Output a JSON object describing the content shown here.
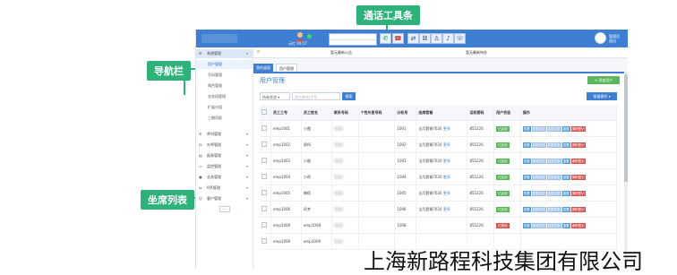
{
  "callouts": {
    "toolbar": "通话工具条",
    "nav": "导航栏",
    "seats": "坐席列表"
  },
  "topbar": {
    "agent_status": "示忙 00:17",
    "user_name": "管理员",
    "user_sub": "退出"
  },
  "notice": {
    "n1": "暂无最新公告",
    "n2": "暂无最新待办"
  },
  "sidebar": {
    "items": [
      {
        "label": "系统管理",
        "icon": "gear-icon"
      },
      {
        "label": "用户管理"
      },
      {
        "label": "号码管理"
      },
      {
        "label": "角色管理"
      },
      {
        "label": "业务组管理"
      },
      {
        "label": "扩展分组"
      },
      {
        "label": "三期用助"
      },
      {
        "label": "呼叫管理",
        "icon": "phone-icon"
      },
      {
        "label": "外呼管理",
        "icon": "headset-icon"
      },
      {
        "label": "报表管理",
        "icon": "report-icon"
      },
      {
        "label": "监控管理",
        "icon": "monitor-icon"
      },
      {
        "label": "业务管理",
        "icon": "briefcase-icon"
      },
      {
        "label": "IVR管理",
        "icon": "flow-icon"
      },
      {
        "label": "客户管理",
        "icon": "users-icon"
      }
    ]
  },
  "tabs": [
    "我的桌面",
    "用户管理"
  ],
  "panel": {
    "title": "用户管理",
    "add_btn": "+ 添加用户",
    "filter_select": "所有状态 ▾",
    "filter_placeholder": "员工姓名/工号",
    "search_btn": "搜索",
    "batch_btn": "批量操作 ▾"
  },
  "table": {
    "headers": [
      "",
      "员工工号",
      "员工姓名",
      "联系号码",
      "个性外显号码",
      "分机号",
      "坐席套餐",
      "话机密码",
      "用户状态",
      "操作"
    ],
    "rows": [
      {
        "id": "emp1001",
        "name": "小霞",
        "ext": "1001",
        "pkg": "当月套餐7020",
        "more": "更多",
        "pwd": "855226",
        "status": "已启用"
      },
      {
        "id": "emp1002",
        "name": "周所",
        "ext": "1002",
        "pkg": "当月套餐7020",
        "more": "更多",
        "pwd": "855226",
        "status": "已启用"
      },
      {
        "id": "emp1003",
        "name": "小磊",
        "ext": "1003",
        "pkg": "当月套餐7020",
        "more": "更多",
        "pwd": "855226",
        "status": "已启用"
      },
      {
        "id": "emp1004",
        "name": "小帮",
        "ext": "1004",
        "pkg": "当月套餐7020",
        "more": "更多",
        "pwd": "855226",
        "status": "已启用"
      },
      {
        "id": "emp1005",
        "name": "楠宿",
        "ext": "1005",
        "pkg": "当月套餐7020",
        "more": "更多",
        "pwd": "855226",
        "status": "已启用"
      },
      {
        "id": "emp1006",
        "name": "阿考",
        "ext": "1006",
        "pkg": "当月套餐7020",
        "more": "更多",
        "pwd": "855226",
        "status": "已启用"
      },
      {
        "id": "emp1008",
        "name": "emp1008",
        "ext": "1008",
        "pkg": "",
        "more": "",
        "pwd": "855226",
        "status": "已禁用"
      },
      {
        "id": "emp1009",
        "name": "emp1009",
        "ext": "",
        "pkg": "",
        "more": "",
        "pwd": "",
        "status": ""
      }
    ],
    "actions": [
      "查看",
      "权限控制",
      "权限控制",
      "重置",
      "离职登记"
    ]
  },
  "company": "上海新路程科技集团有限公司",
  "colors": {
    "accent": "#3e7fd3",
    "callout": "#2fb27a",
    "ok": "#5bb75b",
    "danger": "#d9534f"
  }
}
